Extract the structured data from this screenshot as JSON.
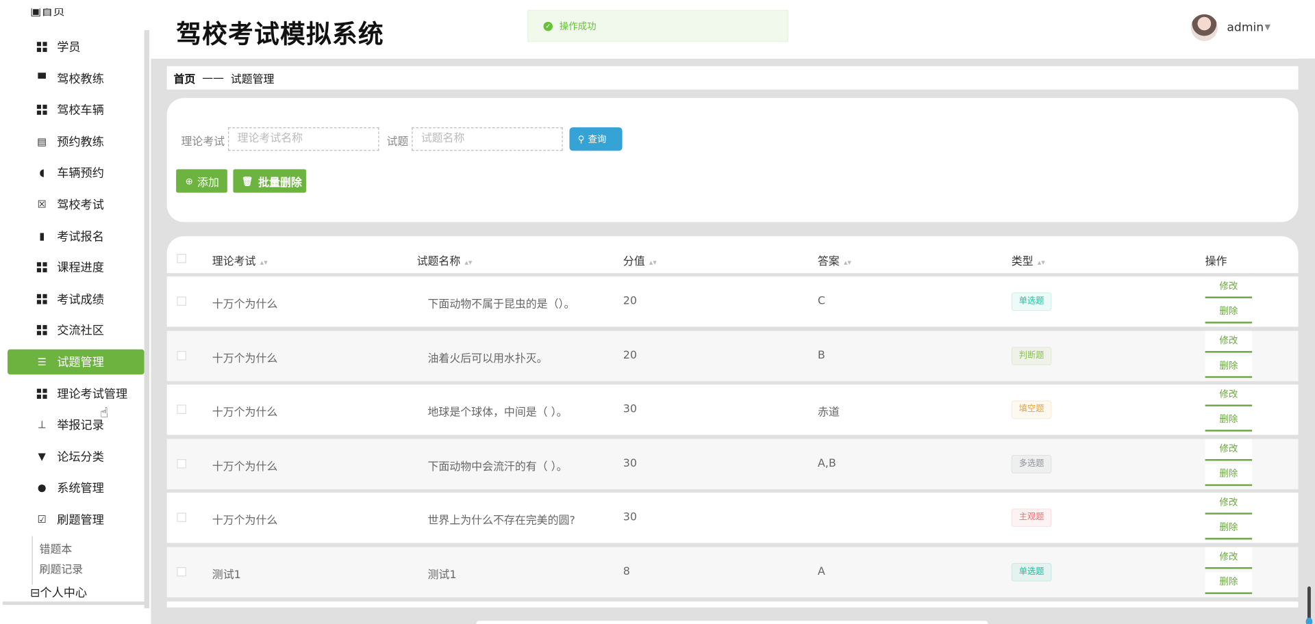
{
  "header": {
    "title": "驾校考试模拟系统",
    "toast": "操作成功",
    "user": "admin"
  },
  "sidebar": {
    "top_item": "首页",
    "items": [
      {
        "label": "学员",
        "icon": "grid-icon"
      },
      {
        "label": "驾校教练",
        "icon": "monitor-icon"
      },
      {
        "label": "驾校车辆",
        "icon": "grid-icon"
      },
      {
        "label": "预约教练",
        "icon": "clipboard-icon"
      },
      {
        "label": "车辆预约",
        "icon": "wallet-icon"
      },
      {
        "label": "驾校考试",
        "icon": "clipboard-x-icon"
      },
      {
        "label": "考试报名",
        "icon": "book-icon"
      },
      {
        "label": "课程进度",
        "icon": "grid-icon"
      },
      {
        "label": "考试成绩",
        "icon": "grid-icon"
      },
      {
        "label": "交流社区",
        "icon": "grid-icon"
      },
      {
        "label": "试题管理",
        "icon": "sliders-icon",
        "active": true
      },
      {
        "label": "理论考试管理",
        "icon": "grid-icon"
      },
      {
        "label": "举报记录",
        "icon": "user-stamp-icon"
      },
      {
        "label": "论坛分类",
        "icon": "pin-icon"
      },
      {
        "label": "系统管理",
        "icon": "user-icon"
      },
      {
        "label": "刷题管理",
        "icon": "clipboard-check-icon"
      }
    ],
    "sub_items": [
      "错题本",
      "刷题记录"
    ],
    "personal": "个人中心",
    "accent": "#6db33f"
  },
  "breadcrumb": {
    "home": "首页",
    "sep": "——",
    "current": "试题管理"
  },
  "search": {
    "exam_label": "理论考试",
    "exam_placeholder": "理论考试名称",
    "question_label": "试题",
    "question_placeholder": "试题名称",
    "query_button": "查询",
    "add_button": "添加",
    "batch_delete_button": "批量删除"
  },
  "table": {
    "columns": [
      "理论考试",
      "试题名称",
      "分值",
      "答案",
      "类型",
      "操作"
    ],
    "edit_label": "修改",
    "delete_label": "删除",
    "rows": [
      {
        "exam": "十万个为什么",
        "question": "下面动物不属于昆虫的是（）。",
        "score": "20",
        "answer": "C",
        "type": "单选题",
        "type_color": "#13c2a0"
      },
      {
        "exam": "十万个为什么",
        "question": "油着火后可以用水扑灭。",
        "score": "20",
        "answer": "B",
        "type": "判断题",
        "type_color": "#8bc34a"
      },
      {
        "exam": "十万个为什么",
        "question": "地球是个球体，中间是（ ）。",
        "score": "30",
        "answer": "赤道",
        "type": "填空题",
        "type_color": "#e6a23c"
      },
      {
        "exam": "十万个为什么",
        "question": "下面动物中会流汗的有（ ）。",
        "score": "30",
        "answer": "A,B",
        "type": "多选题",
        "type_color": "#909399"
      },
      {
        "exam": "十万个为什么",
        "question": "世界上为什么不存在完美的圆?",
        "score": "30",
        "answer": "",
        "type": "主观题",
        "type_color": "#f56c6c"
      },
      {
        "exam": "测试1",
        "question": "测试1",
        "score": "8",
        "answer": "A",
        "type": "单选题",
        "type_color": "#13c2a0"
      }
    ]
  }
}
